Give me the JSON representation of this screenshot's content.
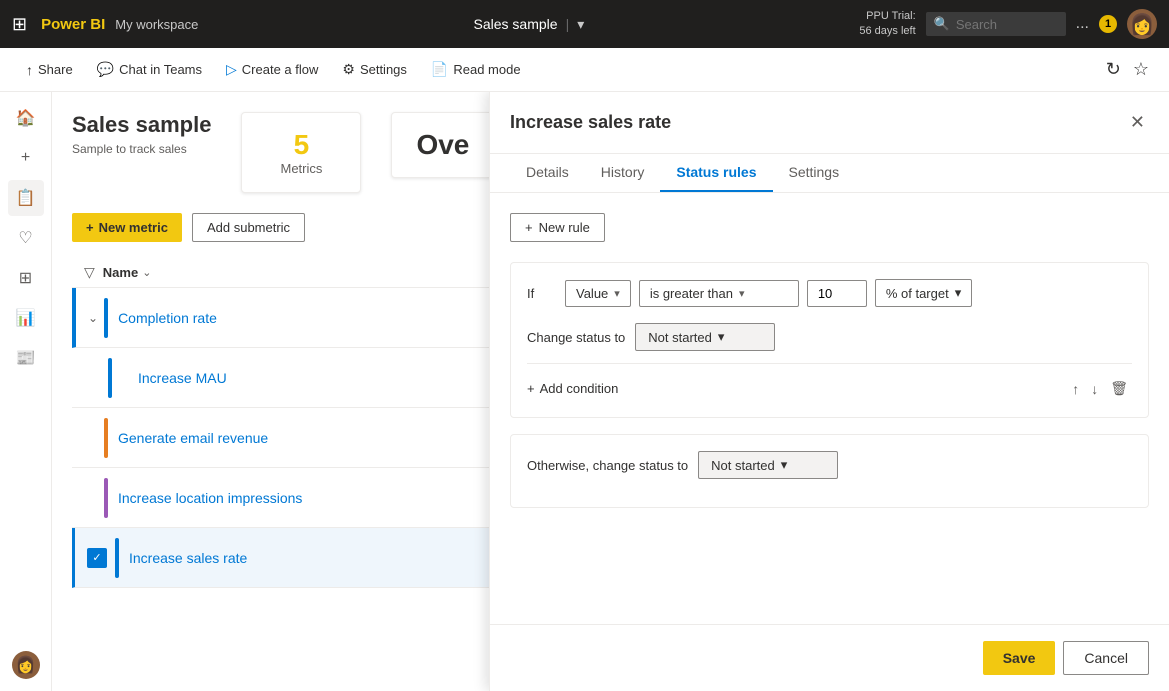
{
  "topbar": {
    "waffle_icon": "⊞",
    "brand_name": "Power BI",
    "workspace_name": "My workspace",
    "report_name": "Sales sample",
    "trial_label": "PPU Trial:",
    "trial_days": "56 days left",
    "search_placeholder": "Search",
    "more_icon": "...",
    "notification_count": "1"
  },
  "toolbar": {
    "share_label": "Share",
    "chat_label": "Chat in Teams",
    "create_flow_label": "Create a flow",
    "settings_label": "Settings",
    "read_mode_label": "Read mode",
    "refresh_icon": "↻",
    "star_icon": "☆"
  },
  "sidebar": {
    "icons": [
      "⊞",
      "+",
      "☰",
      "♡",
      "⊞",
      "≡",
      "⊞"
    ]
  },
  "scorecard": {
    "title": "Sales sample",
    "subtitle": "Sample to track sales",
    "metrics_count": "5",
    "metrics_label": "Metrics",
    "over_label": "Ove"
  },
  "actions": {
    "new_metric_label": "New metric",
    "add_submetric_label": "Add submetric"
  },
  "metrics_list": {
    "name_col_label": "Name",
    "items": [
      {
        "id": "completion_rate",
        "name": "Completion rate",
        "level": 0,
        "color": "#0078d4",
        "expanded": true,
        "has_badge": true
      },
      {
        "id": "increase_mau",
        "name": "Increase MAU",
        "level": 1,
        "color": "#0078d4",
        "expanded": false
      },
      {
        "id": "generate_email",
        "name": "Generate email revenue",
        "level": 0,
        "color": "#e67e22",
        "expanded": false
      },
      {
        "id": "increase_location",
        "name": "Increase location impressions",
        "level": 0,
        "color": "#9b59b6",
        "expanded": false
      },
      {
        "id": "increase_sales",
        "name": "Increase sales rate",
        "level": 0,
        "color": "#0078d4",
        "expanded": false,
        "selected": true
      }
    ]
  },
  "panel": {
    "title": "Increase sales rate",
    "close_icon": "✕",
    "tabs": [
      {
        "id": "details",
        "label": "Details"
      },
      {
        "id": "history",
        "label": "History"
      },
      {
        "id": "status_rules",
        "label": "Status rules",
        "active": true
      },
      {
        "id": "settings",
        "label": "Settings"
      }
    ],
    "new_rule_label": "New rule",
    "rule": {
      "if_label": "If",
      "condition_field": "Value",
      "condition_operator": "is greater than",
      "condition_value": "10",
      "condition_unit": "% of target",
      "change_status_label": "Change status to",
      "status_value": "Not started",
      "add_condition_label": "Add condition"
    },
    "otherwise_label": "Otherwise, change status to",
    "otherwise_value": "Not started",
    "save_label": "Save",
    "cancel_label": "Cancel"
  }
}
